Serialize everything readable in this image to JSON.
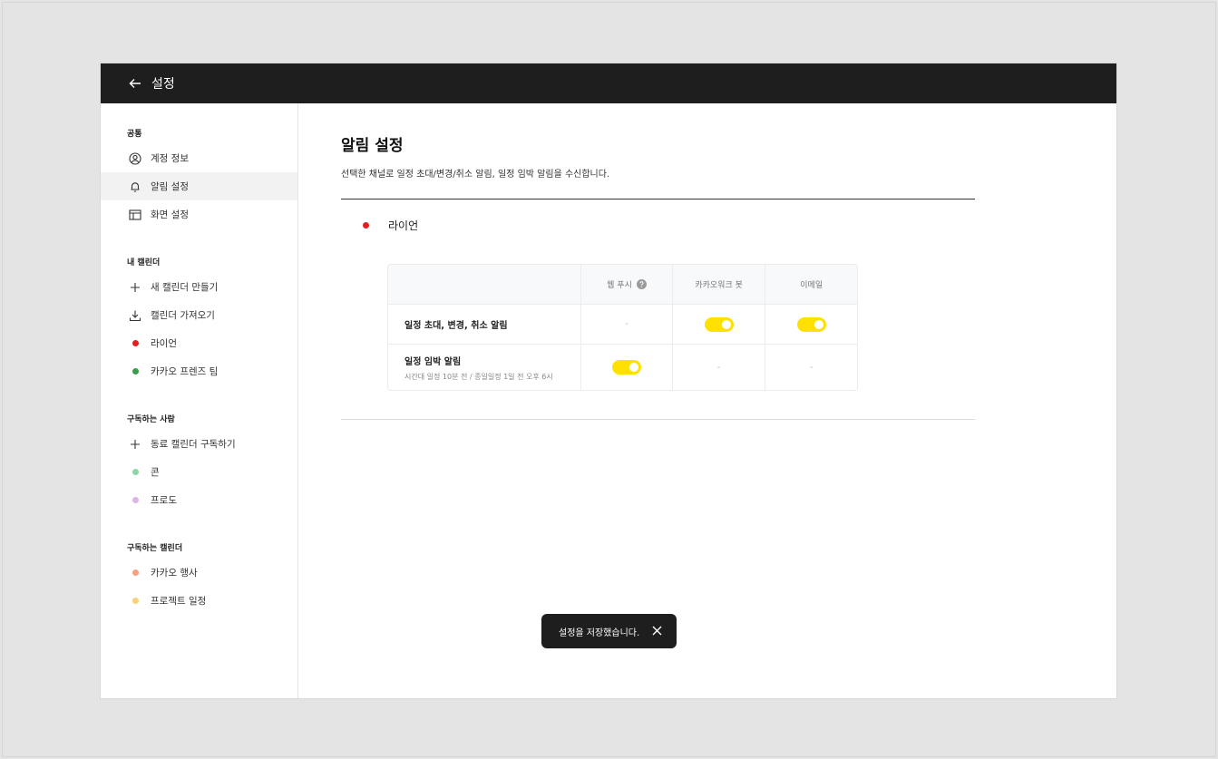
{
  "header": {
    "title": "설정"
  },
  "sidebar": {
    "sections": [
      {
        "title": "공통",
        "items": [
          {
            "label": "계정 정보",
            "icon": "user-circle-icon"
          },
          {
            "label": "알림 설정",
            "icon": "bell-icon",
            "active": true
          },
          {
            "label": "화면 설정",
            "icon": "layout-icon"
          }
        ]
      },
      {
        "title": "내 캘린더",
        "items": [
          {
            "label": "새 캘린더 만들기",
            "icon": "plus-icon"
          },
          {
            "label": "캘린더 가져오기",
            "icon": "download-icon"
          },
          {
            "label": "라이언",
            "color": "#e02020"
          },
          {
            "label": "카카오 프렌즈 팀",
            "color": "#3c9a4f"
          }
        ]
      },
      {
        "title": "구독하는 사람",
        "items": [
          {
            "label": "동료 캘린더 구독하기",
            "icon": "plus-icon"
          },
          {
            "label": "콘",
            "color": "#8fd6a6"
          },
          {
            "label": "프로도",
            "color": "#ddb5e8"
          }
        ]
      },
      {
        "title": "구독하는 캘린더",
        "items": [
          {
            "label": "카카오 행사",
            "color": "#f5a182"
          },
          {
            "label": "프로젝트 일정",
            "color": "#f8d27a"
          }
        ]
      }
    ]
  },
  "main": {
    "title": "알림 설정",
    "description": "선택한 채널로 일정 초대/변경/취소 알림, 일정 임박 알림을 수신합니다.",
    "calendar": {
      "name": "라이언",
      "color": "#e02020"
    },
    "table": {
      "columns": [
        "웹 푸시",
        "카카오워크 봇",
        "이메일"
      ],
      "rows": [
        {
          "label": "일정 초대, 변경, 취소 알림",
          "sub": "",
          "values": [
            "-",
            "on",
            "on"
          ]
        },
        {
          "label": "일정 임박 알림",
          "sub": "시간대 일정 10분 전 / 종일일정 1일 전 오후 6시",
          "values": [
            "on",
            "-",
            "-"
          ]
        }
      ]
    }
  },
  "toast": {
    "message": "설정을 저장했습니다."
  },
  "colors": {
    "accent": "#ffe100",
    "header_bg": "#1e1e1e"
  }
}
